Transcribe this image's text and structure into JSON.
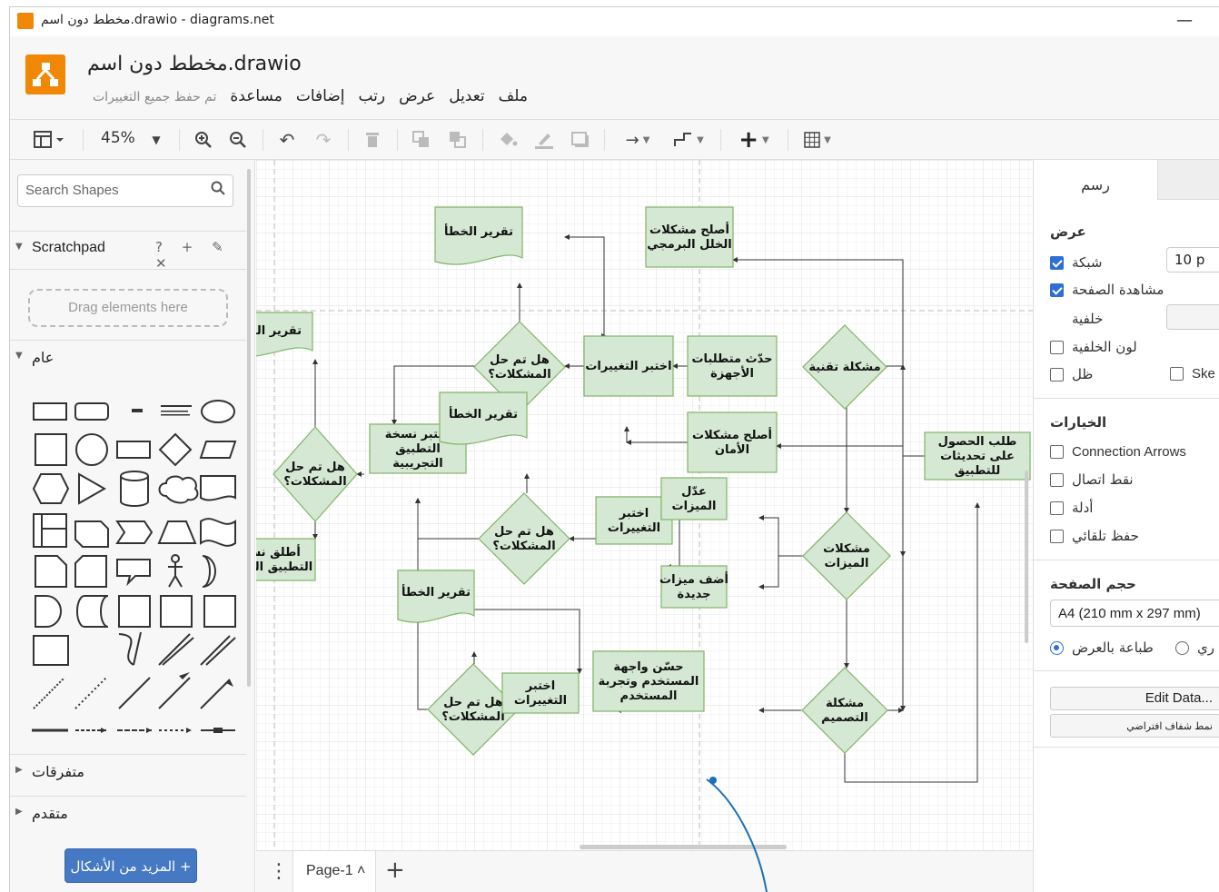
{
  "window": {
    "title": "مخطط دون اسم.drawio - diagrams.net",
    "minimize": "—"
  },
  "header": {
    "doc_title": "مخطط دون اسم.drawio",
    "menu": [
      "ملف",
      "تعديل",
      "عرض",
      "رتب",
      "إضافات",
      "مساعدة"
    ],
    "saved_status": "تم حفظ جميع التغييرات"
  },
  "toolbar": {
    "zoom": "45%"
  },
  "left": {
    "search_placeholder": "Search Shapes",
    "scratchpad": "Scratchpad",
    "scratch_tools": "? + ✎ ✕",
    "drag_hint": "Drag elements here",
    "general": "عام",
    "misc": "متفرقات",
    "advanced": "متقدم",
    "more_shapes": "المزيد من الأشكال +"
  },
  "page_tabs": {
    "tab": "Page-1 ˄",
    "add": "+"
  },
  "right": {
    "tab_diagram": "رسم",
    "view": "عرض",
    "grid": "شبكة",
    "grid_size": "10 p",
    "page_view": "مشاهدة الصفحة",
    "background": "خلفية",
    "bg_color": "لون الخلفية",
    "shadow": "ظل",
    "sketch": "Ske",
    "options": "الخيارات",
    "connection_arrows": "Connection Arrows",
    "connection_points": "نقط اتصال",
    "guides": "أدلة",
    "autosave": "حفظ تلقائي",
    "page_size": "حجم الصفحة",
    "page_size_value": "A4 (210 mm x 297 mm)",
    "landscape": "طباعة بالعرض",
    "portrait": "ري",
    "edit_data": "Edit Data...",
    "default_style": "نمط شفاف افتراضي"
  },
  "diagram": {
    "nodes": {
      "fix_bugs": "أصلح مشكلات|الخلل البرمجي",
      "error_report_1": "تقرير الخطأ",
      "error_report_2": "تقرير الخطأ",
      "error_report_3": "تقرير الخطأ",
      "error_report_4": "تقرير الخطأ",
      "solved_1": "هل تم حل|المشكلات؟",
      "solved_2": "هل تم حل|المشكلات؟",
      "solved_3": "هل تم حل|المشكلات؟",
      "solved_4": "هل تم حل|المشكلات؟",
      "test_changes_1": "اختبر التغييرات",
      "test_changes_2": "اختبر|التغييرات",
      "test_changes_3": "اختبر|التغييرات",
      "update_hw": "حدّث متطلبات|الأجهزة",
      "tech_problem": "مشكلة تقنية",
      "fix_security": "أصلح مشكلات|الأمان",
      "test_trial": "اختبر نسخة|التطبيق|التجريبية",
      "request_updates": "طلب الحصول|على تحديثات|للتطبيق",
      "edit_features": "عدّل|الميزات",
      "feature_problems": "مشكلات|الميزات",
      "add_features": "أضف ميزات|جديدة",
      "release": "أطلق نسخة|التطبيق الجديدة",
      "improve_ui": "حسّن واجهة|المستخدم وتجربة|المستخدم",
      "design_problem": "مشكلة|التصميم"
    }
  }
}
